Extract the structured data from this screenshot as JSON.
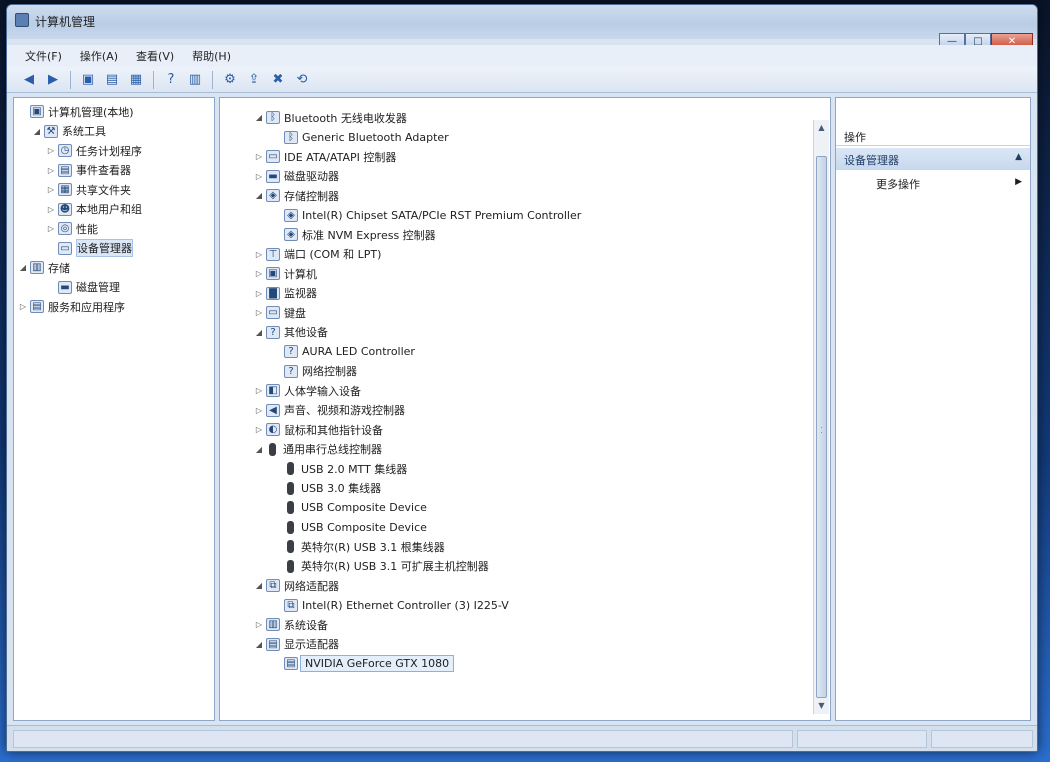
{
  "window": {
    "title": "计算机管理"
  },
  "controls": {
    "minimize": "—",
    "maximize": "□",
    "close": "✕"
  },
  "menu": [
    "文件(F)",
    "操作(A)",
    "查看(V)",
    "帮助(H)"
  ],
  "left_tree": [
    {
      "label": "计算机管理(本地)",
      "indent": 0,
      "exp": "",
      "icon": "computer-management-icon"
    },
    {
      "label": "系统工具",
      "indent": 1,
      "exp": "◢",
      "icon": "tools-icon"
    },
    {
      "label": "任务计划程序",
      "indent": 2,
      "exp": "▷",
      "icon": "clock-icon"
    },
    {
      "label": "事件查看器",
      "indent": 2,
      "exp": "▷",
      "icon": "event-viewer-icon"
    },
    {
      "label": "共享文件夹",
      "indent": 2,
      "exp": "▷",
      "icon": "shared-folder-icon"
    },
    {
      "label": "本地用户和组",
      "indent": 2,
      "exp": "▷",
      "icon": "users-icon"
    },
    {
      "label": "性能",
      "indent": 2,
      "exp": "▷",
      "icon": "performance-icon"
    },
    {
      "label": "设备管理器",
      "indent": 2,
      "exp": "",
      "icon": "device-manager-icon",
      "selected": true
    },
    {
      "label": "存储",
      "indent": 0,
      "exp": "◢",
      "icon": "storage-icon"
    },
    {
      "label": "磁盘管理",
      "indent": 2,
      "exp": "",
      "icon": "disk-management-icon"
    },
    {
      "label": "服务和应用程序",
      "indent": 0,
      "exp": "▷",
      "icon": "services-icon"
    }
  ],
  "device_tree": [
    {
      "label": "Bluetooth 无线电收发器",
      "indent": 0,
      "exp": "◢",
      "icon": "bluetooth-icon"
    },
    {
      "label": "Generic Bluetooth Adapter",
      "indent": 1,
      "exp": "",
      "icon": "bluetooth-icon"
    },
    {
      "label": "IDE ATA/ATAPI 控制器",
      "indent": 0,
      "exp": "▷",
      "icon": "ide-controller-icon"
    },
    {
      "label": "磁盘驱动器",
      "indent": 0,
      "exp": "▷",
      "icon": "disk-drive-icon"
    },
    {
      "label": "存储控制器",
      "indent": 0,
      "exp": "◢",
      "icon": "storage-controller-icon"
    },
    {
      "label": "Intel(R) Chipset SATA/PCIe RST Premium Controller",
      "indent": 1,
      "exp": "",
      "icon": "storage-controller-icon"
    },
    {
      "label": "标准 NVM Express 控制器",
      "indent": 1,
      "exp": "",
      "icon": "storage-controller-icon"
    },
    {
      "label": "端口 (COM 和 LPT)",
      "indent": 0,
      "exp": "▷",
      "icon": "port-icon"
    },
    {
      "label": "计算机",
      "indent": 0,
      "exp": "▷",
      "icon": "computer-icon"
    },
    {
      "label": "监视器",
      "indent": 0,
      "exp": "▷",
      "icon": "monitor-icon"
    },
    {
      "label": "键盘",
      "indent": 0,
      "exp": "▷",
      "icon": "keyboard-icon"
    },
    {
      "label": "其他设备",
      "indent": 0,
      "exp": "◢",
      "icon": "other-device-icon"
    },
    {
      "label": "AURA LED Controller",
      "indent": 1,
      "exp": "",
      "icon": "unknown-device-icon"
    },
    {
      "label": "网络控制器",
      "indent": 1,
      "exp": "",
      "icon": "unknown-device-icon"
    },
    {
      "label": "人体学输入设备",
      "indent": 0,
      "exp": "▷",
      "icon": "hid-icon"
    },
    {
      "label": "声音、视频和游戏控制器",
      "indent": 0,
      "exp": "▷",
      "icon": "sound-icon"
    },
    {
      "label": "鼠标和其他指针设备",
      "indent": 0,
      "exp": "▷",
      "icon": "mouse-icon"
    },
    {
      "label": "通用串行总线控制器",
      "indent": 0,
      "exp": "◢",
      "icon": "usb-icon"
    },
    {
      "label": "USB 2.0 MTT 集线器",
      "indent": 1,
      "exp": "",
      "icon": "usb-icon"
    },
    {
      "label": "USB 3.0 集线器",
      "indent": 1,
      "exp": "",
      "icon": "usb-icon"
    },
    {
      "label": "USB Composite Device",
      "indent": 1,
      "exp": "",
      "icon": "usb-icon"
    },
    {
      "label": "USB Composite Device",
      "indent": 1,
      "exp": "",
      "icon": "usb-icon"
    },
    {
      "label": "英特尔(R) USB 3.1 根集线器",
      "indent": 1,
      "exp": "",
      "icon": "usb-icon"
    },
    {
      "label": "英特尔(R) USB 3.1 可扩展主机控制器",
      "indent": 1,
      "exp": "",
      "icon": "usb-icon"
    },
    {
      "label": "网络适配器",
      "indent": 0,
      "exp": "◢",
      "icon": "network-adapter-icon"
    },
    {
      "label": "Intel(R) Ethernet Controller (3) I225-V",
      "indent": 1,
      "exp": "",
      "icon": "network-adapter-icon"
    },
    {
      "label": "系统设备",
      "indent": 0,
      "exp": "▷",
      "icon": "system-device-icon"
    },
    {
      "label": "显示适配器",
      "indent": 0,
      "exp": "◢",
      "icon": "display-adapter-icon"
    },
    {
      "label": "NVIDIA GeForce GTX 1080",
      "indent": 1,
      "exp": "",
      "icon": "display-adapter-icon",
      "selected": true
    }
  ],
  "actions": {
    "header": "操作",
    "section": "设备管理器",
    "more": "更多操作"
  }
}
